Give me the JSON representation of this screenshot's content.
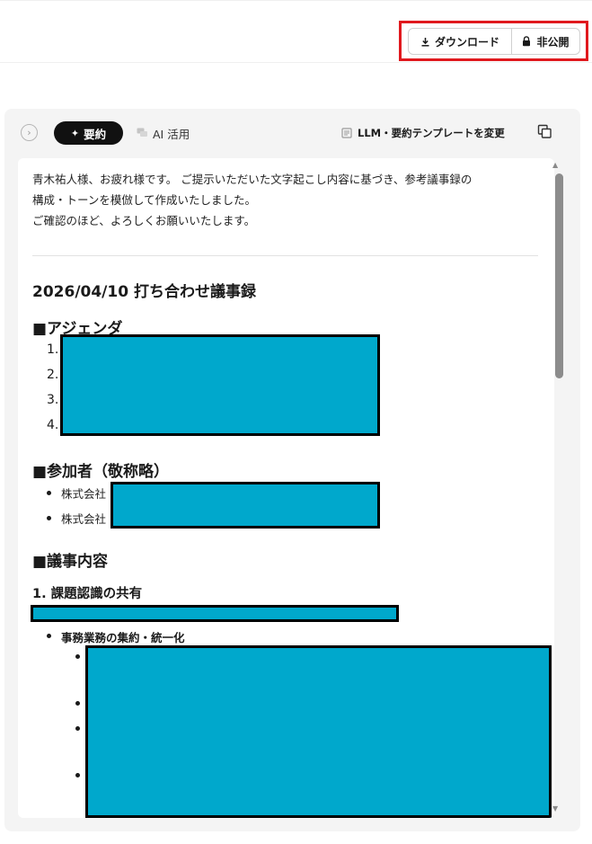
{
  "toolbar": {
    "download_label": "ダウンロード",
    "private_label": "非公開",
    "download_icon": "download-icon",
    "lock_icon": "lock-icon"
  },
  "tabs": {
    "summary_label": "要約",
    "ai_label": "AI 活用",
    "template_label": "LLM・要約テンプレートを変更"
  },
  "content": {
    "intro_lines": [
      "青木祐人様、お疲れ様です。 ご提示いただいた文字起こし内容に基づき、参考議事録の",
      "構成・トーンを模倣して作成いたしました。",
      "ご確認のほど、よろしくお願いいたします。"
    ],
    "doc_title": "2026/04/10 打ち合わせ議事録",
    "agenda_heading": "■アジェンダ",
    "agenda_numbers": [
      "1.",
      "2.",
      "3.",
      "4."
    ],
    "attendees_heading": "■参加者（敬称略）",
    "attendees": [
      "株式会社",
      "株式会社"
    ],
    "minutes_heading": "■議事内容",
    "section1_heading": "1. 課題認識の共有",
    "section1_item": "事務業務の集約・統一化"
  },
  "colors": {
    "redaction": "#00a8cc",
    "highlight_border": "#e0191e",
    "active_tab": "#111111"
  }
}
